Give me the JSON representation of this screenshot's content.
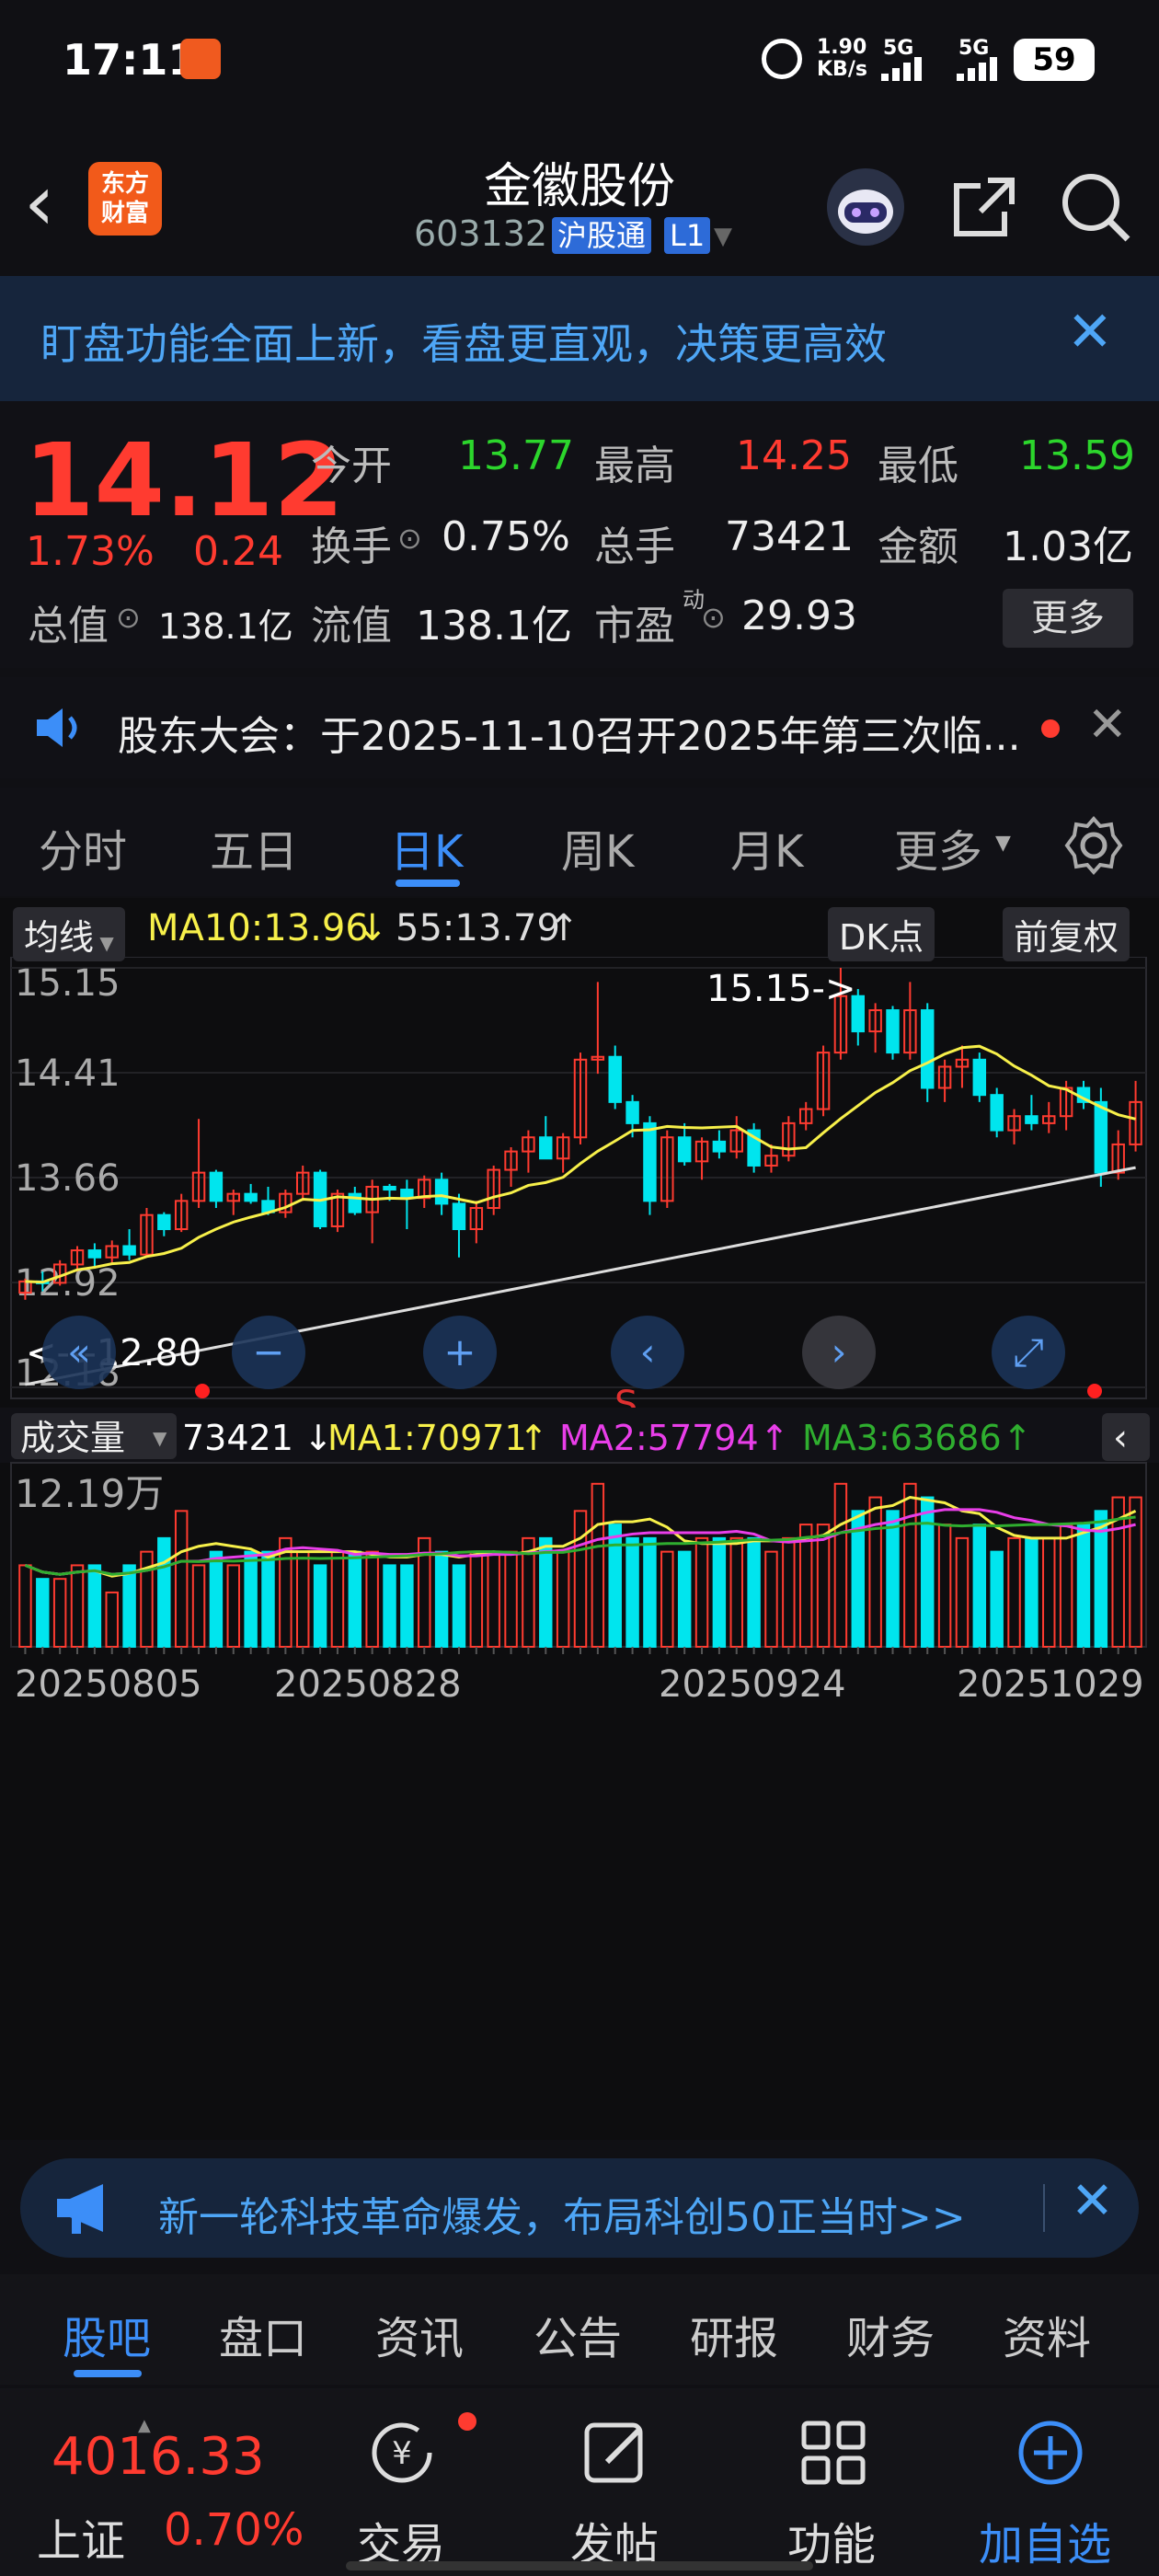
{
  "status_bar": {
    "time": "17:11",
    "net_speed": "1.90\nKB/s",
    "net_1": "5G",
    "net_2": "5G",
    "battery": "59"
  },
  "header": {
    "logo": "东方\n财富",
    "stock_name": "金徽股份",
    "stock_code": "603132",
    "tag_1": "沪股通",
    "tag_2": "L1"
  },
  "banner": {
    "text": "盯盘功能全面上新，看盘更直观，决策更高效"
  },
  "quote": {
    "price": "14.12",
    "change_pct": "1.73%",
    "change": "0.24",
    "open_label": "今开",
    "open": "13.77",
    "high_label": "最高",
    "high": "14.25",
    "low_label": "最低",
    "low": "13.59",
    "turnover_label": "换手",
    "turnover": "0.75%",
    "volume_label": "总手",
    "volume": "73421",
    "amount_label": "金额",
    "amount": "1.03亿",
    "mcap_label": "总值",
    "mcap": "138.1亿",
    "float_label": "流值",
    "float_mcap": "138.1亿",
    "pe_label": "市盈",
    "pe_sup": "动",
    "pe": "29.93",
    "more": "更多"
  },
  "notice": {
    "text": "股东大会：于2025-11-10召开2025年第三次临..."
  },
  "tabs": [
    "分时",
    "五日",
    "日K",
    "周K",
    "月K",
    "更多"
  ],
  "kline_bar": {
    "ma_label": "均线",
    "ma10": "MA10:13.96",
    "ma10_arrow": "↓",
    "ma55": "55:13.79",
    "ma55_arrow": "↑",
    "dk": "DK点",
    "fq": "前复权"
  },
  "kline_axis": [
    "15.15",
    "14.41",
    "13.66",
    "12.92",
    "12.18"
  ],
  "kline_annot": {
    "max": "15.15->",
    "min": "<---12.80",
    "s_mark": "S"
  },
  "vol_bar": {
    "label": "成交量",
    "vol": "73421",
    "vol_arrow": "↓",
    "ma1": "MA1:70971",
    "ma1_arrow": "↑",
    "ma2": "MA2:57794",
    "ma2_arrow": "↑",
    "ma3": "MA3:63686",
    "ma3_arrow": "↑"
  },
  "vol_axis": "12.19万",
  "dates": [
    "20250805",
    "20250828",
    "20250924",
    "20251029"
  ],
  "ad": {
    "text": "新一轮科技革命爆发，布局科创50正当时>>"
  },
  "subtabs": [
    "股吧",
    "盘口",
    "资讯",
    "公告",
    "研报",
    "财务",
    "资料"
  ],
  "bottom_nav": {
    "index_value": "4016.33",
    "index_name": "上证",
    "index_pct": "0.70%",
    "trade": "交易",
    "post": "发帖",
    "func": "功能",
    "add": "加自选"
  },
  "colors": {
    "up": "#ff3b30",
    "down": "#00e5ee",
    "accent": "#3c8ef8",
    "ma_yellow": "#f7f04a",
    "ma_white": "#dddddd",
    "ma2_magenta": "#e93ee9",
    "ma3_green": "#2fae2f"
  },
  "chart_data": {
    "type": "candlestick",
    "y_range": [
      12.18,
      15.15
    ],
    "candles": [
      [
        12.85,
        12.95,
        12.8,
        12.93
      ],
      [
        12.93,
        13.0,
        12.86,
        12.92
      ],
      [
        12.92,
        13.08,
        12.9,
        13.05
      ],
      [
        13.05,
        13.18,
        13.0,
        13.15
      ],
      [
        13.15,
        13.2,
        13.02,
        13.1
      ],
      [
        13.1,
        13.22,
        13.05,
        13.18
      ],
      [
        13.18,
        13.3,
        13.08,
        13.12
      ],
      [
        13.12,
        13.45,
        13.1,
        13.4
      ],
      [
        13.4,
        13.42,
        13.25,
        13.3
      ],
      [
        13.3,
        13.55,
        13.28,
        13.5
      ],
      [
        13.5,
        14.08,
        13.45,
        13.7
      ],
      [
        13.7,
        13.72,
        13.45,
        13.5
      ],
      [
        13.5,
        13.58,
        13.4,
        13.55
      ],
      [
        13.55,
        13.62,
        13.48,
        13.5
      ],
      [
        13.5,
        13.6,
        13.4,
        13.42
      ],
      [
        13.42,
        13.58,
        13.38,
        13.55
      ],
      [
        13.55,
        13.75,
        13.5,
        13.7
      ],
      [
        13.7,
        13.72,
        13.3,
        13.32
      ],
      [
        13.32,
        13.58,
        13.28,
        13.55
      ],
      [
        13.55,
        13.6,
        13.4,
        13.42
      ],
      [
        13.42,
        13.65,
        13.2,
        13.6
      ],
      [
        13.6,
        13.62,
        13.5,
        13.58
      ],
      [
        13.58,
        13.65,
        13.3,
        13.52
      ],
      [
        13.52,
        13.68,
        13.45,
        13.65
      ],
      [
        13.65,
        13.7,
        13.4,
        13.48
      ],
      [
        13.48,
        13.55,
        13.1,
        13.3
      ],
      [
        13.3,
        13.5,
        13.2,
        13.45
      ],
      [
        13.45,
        13.75,
        13.4,
        13.72
      ],
      [
        13.72,
        13.88,
        13.6,
        13.85
      ],
      [
        13.85,
        14.0,
        13.7,
        13.95
      ],
      [
        13.95,
        14.1,
        13.8,
        13.8
      ],
      [
        13.8,
        13.98,
        13.7,
        13.95
      ],
      [
        13.95,
        14.55,
        13.9,
        14.5
      ],
      [
        14.5,
        15.05,
        14.4,
        14.52
      ],
      [
        14.52,
        14.6,
        14.15,
        14.2
      ],
      [
        14.2,
        14.25,
        13.95,
        14.05
      ],
      [
        14.05,
        14.1,
        13.4,
        13.5
      ],
      [
        13.5,
        14.0,
        13.45,
        13.95
      ],
      [
        13.95,
        14.05,
        13.75,
        13.78
      ],
      [
        13.78,
        13.95,
        13.65,
        13.92
      ],
      [
        13.92,
        14.0,
        13.8,
        13.85
      ],
      [
        13.85,
        14.1,
        13.8,
        14.0
      ],
      [
        14.0,
        14.05,
        13.7,
        13.75
      ],
      [
        13.75,
        13.9,
        13.7,
        13.82
      ],
      [
        13.82,
        14.1,
        13.78,
        14.05
      ],
      [
        14.05,
        14.2,
        14.0,
        14.15
      ],
      [
        14.15,
        14.6,
        14.1,
        14.55
      ],
      [
        14.55,
        15.15,
        14.5,
        14.95
      ],
      [
        14.95,
        15.0,
        14.6,
        14.7
      ],
      [
        14.7,
        14.9,
        14.55,
        14.85
      ],
      [
        14.85,
        14.88,
        14.5,
        14.55
      ],
      [
        14.55,
        15.05,
        14.5,
        14.85
      ],
      [
        14.85,
        14.9,
        14.2,
        14.3
      ],
      [
        14.3,
        14.5,
        14.2,
        14.45
      ],
      [
        14.45,
        14.6,
        14.3,
        14.5
      ],
      [
        14.5,
        14.55,
        14.2,
        14.25
      ],
      [
        14.25,
        14.3,
        13.95,
        14.0
      ],
      [
        14.0,
        14.15,
        13.9,
        14.1
      ],
      [
        14.1,
        14.25,
        14.0,
        14.05
      ],
      [
        14.05,
        14.2,
        13.98,
        14.1
      ],
      [
        14.1,
        14.35,
        14.0,
        14.3
      ],
      [
        14.3,
        14.35,
        14.15,
        14.2
      ],
      [
        14.2,
        14.3,
        13.6,
        13.7
      ],
      [
        13.7,
        14.0,
        13.65,
        13.9
      ],
      [
        13.9,
        14.35,
        13.85,
        14.2
      ]
    ],
    "volume_scale": 12.19,
    "volumes": [
      6,
      5,
      5,
      6,
      6,
      4,
      6,
      7,
      8,
      10,
      6,
      7,
      6,
      7,
      7,
      8,
      7,
      6,
      7,
      7,
      7,
      6,
      6,
      8,
      7,
      6,
      7,
      7,
      7,
      8,
      8,
      7,
      10,
      12,
      9,
      8,
      8,
      7,
      7,
      8,
      8,
      8,
      8,
      7,
      8,
      9,
      9,
      12,
      10,
      11,
      10,
      12,
      11,
      9,
      8,
      9,
      7,
      8,
      8,
      8,
      9,
      9,
      10,
      11,
      11
    ]
  }
}
